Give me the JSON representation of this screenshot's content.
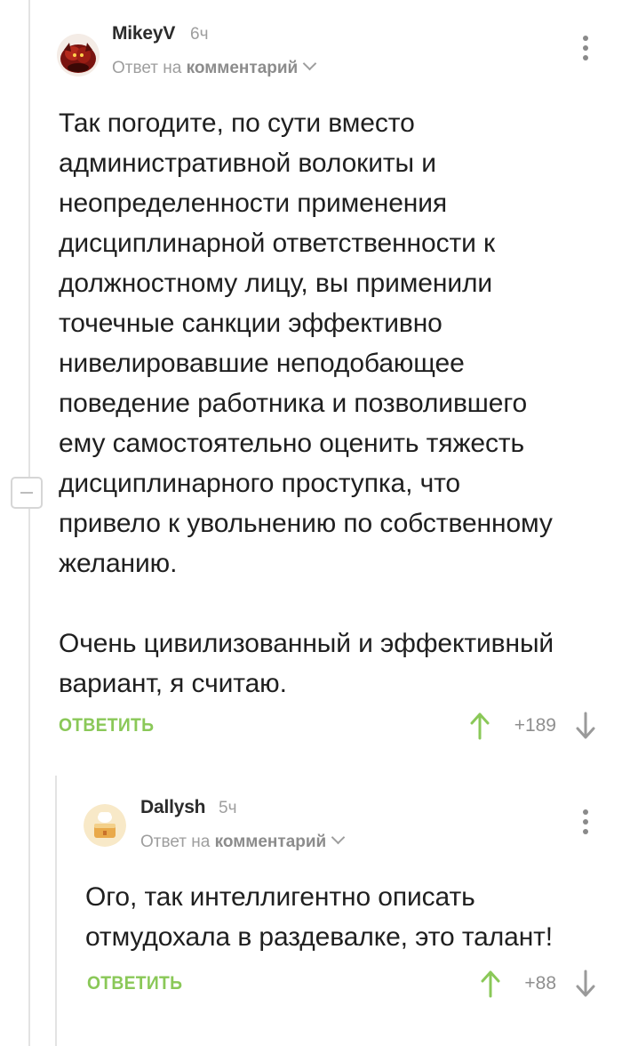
{
  "comments": [
    {
      "author": "MikeyV",
      "time": "6ч",
      "reply_prefix": "Ответ на",
      "reply_target": "комментарий",
      "text": "Так погодите, по сути вместо\nадминистративной волокиты и\nнеопределенности применения\nдисциплинарной ответственности к\nдолжностному лицу, вы применили\nточечные санкции эффективно\nнивелировавшие неподобающее\nповедение работника и позволившего\nему самостоятельно оценить тяжесть\nдисциплинарного проступка, что\nпривело к увольнению по собственному\nжеланию.\n\nОчень цивилизованный и эффективный\nвариант, я считаю.",
      "reply_label": "ОТВЕТИТЬ",
      "rating": "+189",
      "avatar_icon": "demon-warrior-avatar"
    },
    {
      "author": "Dallysh",
      "time": "5ч",
      "reply_prefix": "Ответ на",
      "reply_target": "комментарий",
      "text": "Ого, так интеллигентно описать\nотмудохала в раздевалке, это талант!",
      "reply_label": "ОТВЕТИТЬ",
      "rating": "+88",
      "avatar_icon": "cake-avatar"
    }
  ],
  "colors": {
    "accent_green": "#8ac858",
    "muted": "#9e9e9e",
    "text": "#1f1f1f"
  }
}
